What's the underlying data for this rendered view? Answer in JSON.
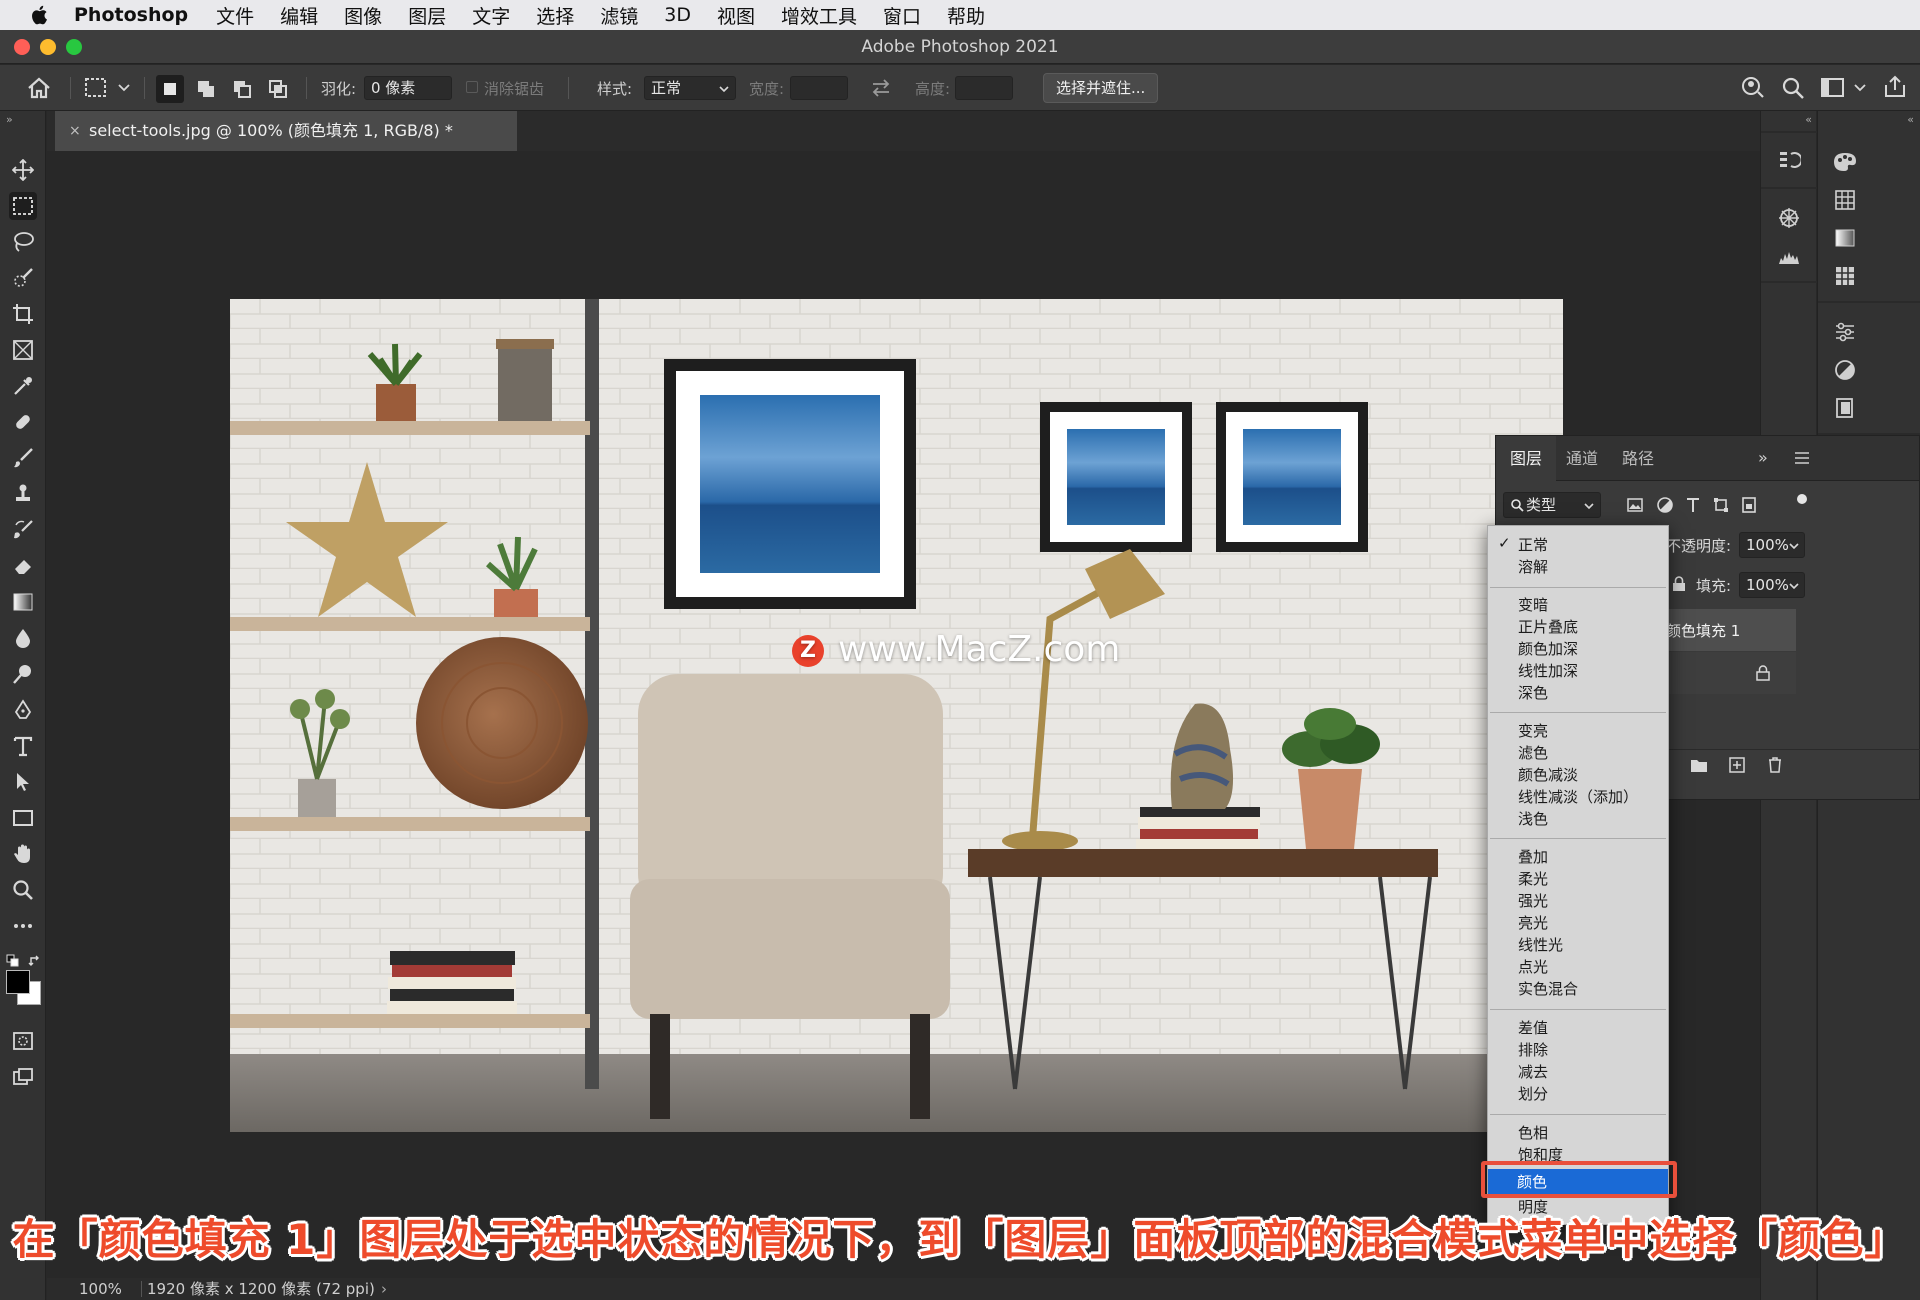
{
  "menubar": {
    "items": [
      "Photoshop",
      "文件",
      "编辑",
      "图像",
      "图层",
      "文字",
      "选择",
      "滤镜",
      "3D",
      "视图",
      "增效工具",
      "窗口",
      "帮助"
    ]
  },
  "window": {
    "title": "Adobe Photoshop 2021"
  },
  "options_bar": {
    "feather_label": "羽化:",
    "feather_value": "0 像素",
    "antialias_label": "消除锯齿",
    "style_label": "样式:",
    "style_value": "正常",
    "width_label": "宽度:",
    "height_label": "高度:",
    "select_mask_button": "选择并遮住..."
  },
  "document": {
    "tab_title": "select-tools.jpg @ 100% (颜色填充 1, RGB/8) *",
    "close_glyph": "×"
  },
  "watermark": {
    "text": "www.MacZ.com",
    "badge": "Z"
  },
  "layers_panel": {
    "tabs": [
      "图层",
      "通道",
      "路径"
    ],
    "filter_value": "类型",
    "opacity_label": "不透明度:",
    "opacity_value": "100%",
    "fill_label": "填充:",
    "fill_value": "100%",
    "layer_name": "颜色填充 1"
  },
  "blend_menu": {
    "groups": [
      [
        "正常",
        "溶解"
      ],
      [
        "变暗",
        "正片叠底",
        "颜色加深",
        "线性加深",
        "深色"
      ],
      [
        "变亮",
        "滤色",
        "颜色减淡",
        "线性减淡（添加）",
        "浅色"
      ],
      [
        "叠加",
        "柔光",
        "强光",
        "亮光",
        "线性光",
        "点光",
        "实色混合"
      ],
      [
        "差值",
        "排除",
        "减去",
        "划分"
      ],
      [
        "色相",
        "饱和度"
      ]
    ],
    "checked": "正常",
    "highlighted": "颜色",
    "after": "明度"
  },
  "caption": "在「颜色填充 1」图层处于选中状态的情况下，到「图层」面板顶部的混合模式菜单中选择「颜色」",
  "status_bar": {
    "zoom": "100%",
    "doc_info": "1920 像素 x 1200 像素 (72 ppi)"
  },
  "colors": {
    "accent_highlight": "#1a6ad6",
    "caption_red": "#ee4b2b",
    "ui_dark": "#323232"
  }
}
